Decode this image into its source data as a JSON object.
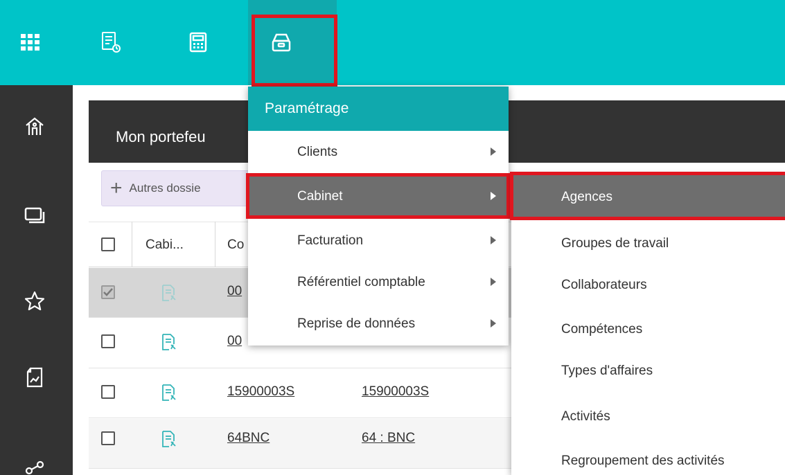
{
  "topbar": {
    "icons": [
      "apps-grid-icon",
      "report-list-icon",
      "calculator-icon",
      "archive-tray-icon"
    ],
    "active_icon": "archive-tray-icon",
    "color": "#00c4c8",
    "active_color": "#10a9ad"
  },
  "sidebar": {
    "icons": [
      "home-icon",
      "windows-icon",
      "star-icon",
      "chart-document-icon",
      "share-icon"
    ],
    "color": "#333333"
  },
  "portfolio": {
    "title": "Mon portefeu",
    "other_button": "Autres dossie",
    "headers": [
      "Cabi...",
      "Co"
    ],
    "rows": [
      {
        "checked": true,
        "code": "00",
        "label": ""
      },
      {
        "checked": false,
        "code": "00",
        "label": ""
      },
      {
        "checked": false,
        "code": "15900003S",
        "label": "15900003S"
      },
      {
        "checked": false,
        "code": "64BNC",
        "label": "64 : BNC"
      }
    ]
  },
  "menu": {
    "header": "Paramétrage",
    "items": [
      {
        "label": "Clients",
        "active": false
      },
      {
        "label": "Cabinet",
        "active": true
      },
      {
        "label": "Facturation",
        "active": false
      },
      {
        "label": "Référentiel comptable",
        "active": false
      },
      {
        "label": "Reprise de données",
        "active": false
      }
    ]
  },
  "submenu": {
    "items": [
      {
        "label": "Agences",
        "active": true
      },
      {
        "label": "Groupes de travail",
        "active": false
      },
      {
        "label": "Collaborateurs",
        "active": false
      },
      {
        "label": "Compétences",
        "active": false
      },
      {
        "label": "Types d'affaires",
        "active": false
      },
      {
        "label": "Activités",
        "active": false
      },
      {
        "label": "Regroupement des activités",
        "active": false
      }
    ]
  },
  "colors": {
    "highlight_red": "#e0161f",
    "menu_active": "#6e6e6e",
    "dark_panel": "#333333"
  }
}
